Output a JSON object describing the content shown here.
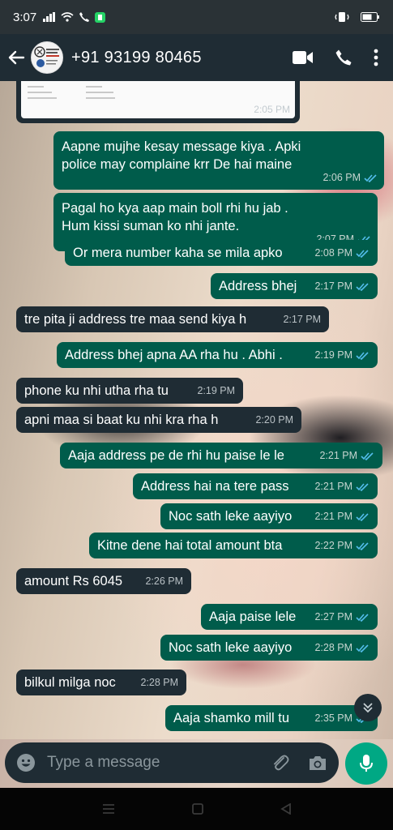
{
  "status_bar": {
    "time": "3:07"
  },
  "header": {
    "contact": "+91 93199 80465"
  },
  "quoted_card": {
    "time": "2:05 PM"
  },
  "messages": [
    {
      "dir": "out",
      "text": "Aapne mujhe kesay message kiya . Apki police may  complaine krr De hai maine",
      "time": "2:06 PM"
    },
    {
      "dir": "out",
      "text": "Pagal ho kya aap main boll rhi hu  jab . Hum kissi suman ko nhi jante.",
      "time": "2:07 PM"
    },
    {
      "dir": "out",
      "text": "Or mera number kaha se mila apko",
      "time": "2:08 PM"
    },
    {
      "dir": "out",
      "text": "Address bhej",
      "time": "2:17 PM"
    },
    {
      "dir": "in",
      "text": "tre pita ji address tre maa send kiya h",
      "time": "2:17 PM"
    },
    {
      "dir": "out",
      "text": "Address bhej apna AA rha hu . Abhi .",
      "time": "2:19 PM"
    },
    {
      "dir": "in",
      "text": "phone ku nhi utha rha tu",
      "time": "2:19 PM"
    },
    {
      "dir": "in",
      "text": "apni maa si baat ku nhi kra  rha h",
      "time": "2:20 PM"
    },
    {
      "dir": "out",
      "text": "Aaja address pe de rhi hu paise le le",
      "time": "2:21 PM"
    },
    {
      "dir": "out",
      "text": "Address hai na tere pass",
      "time": "2:21 PM"
    },
    {
      "dir": "out",
      "text": "Noc sath leke aayiyo",
      "time": "2:21 PM"
    },
    {
      "dir": "out",
      "text": "Kitne dene hai total amount bta",
      "time": "2:22 PM"
    },
    {
      "dir": "in",
      "text": "amount Rs 6045",
      "time": "2:26 PM"
    },
    {
      "dir": "out",
      "text": "Aaja paise lele",
      "time": "2:27 PM"
    },
    {
      "dir": "out",
      "text": "Noc sath leke aayiyo",
      "time": "2:28 PM"
    },
    {
      "dir": "in",
      "text": "bilkul milga noc",
      "time": "2:28 PM"
    },
    {
      "dir": "out",
      "text": "Aaja shamko mill tu",
      "time": "2:35 PM"
    }
  ],
  "composer": {
    "placeholder": "Type a message"
  },
  "colors": {
    "outgoing": "#005c4b",
    "incoming": "#1f2c34",
    "read_ticks": "#53bdeb",
    "accent": "#00a884"
  },
  "icons": [
    "back-arrow-icon",
    "video-call-icon",
    "phone-call-icon",
    "more-options-icon",
    "emoji-icon",
    "attach-icon",
    "camera-icon",
    "mic-icon",
    "scroll-down-icon",
    "read-receipt-icon"
  ]
}
